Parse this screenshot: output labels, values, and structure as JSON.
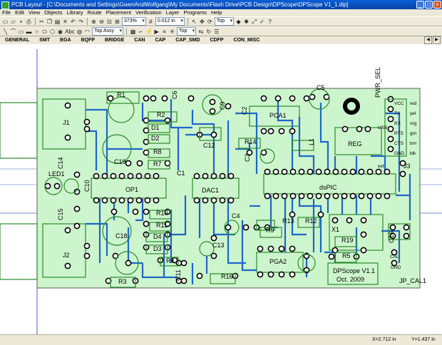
{
  "window": {
    "title": "PCB Layout - [C:\\Documents and Settings\\GwenAndWolfgang\\My Documents\\Flash Drive\\PCB Design\\DPScope\\DPScope V1_1.dip]"
  },
  "menu": [
    "File",
    "Edit",
    "View",
    "Objects",
    "Library",
    "Route",
    "Placement",
    "Verification",
    "Layer",
    "Programs",
    "Help"
  ],
  "toolbar1": {
    "zoom_value": "373%",
    "grid_value": "0.012 in",
    "layer_value": "Top"
  },
  "toolbar2": {
    "layer_pair_value": "Top Assy",
    "text_label": "Abc",
    "route_layer_value": "Top"
  },
  "component_tabs": [
    "GENERAL",
    "SMT",
    "BGA",
    "BQFP",
    "BRIDGE",
    "CAN",
    "CAP",
    "CAP_SMD",
    "CDFP",
    "CON_MISC"
  ],
  "board": {
    "refs": [
      "R1",
      "C6",
      "C9",
      "C5",
      "PWR_SEL",
      "C2",
      "PCA1",
      "VCC",
      "red",
      "TX",
      "yel",
      "RX",
      "org",
      "RTS",
      "grn",
      "CTS",
      "brn",
      "GND",
      "blk",
      "J1",
      "R2",
      "D1",
      "D2",
      "C12",
      "R14",
      "L1",
      "REG",
      "USB",
      "R8",
      "R7",
      "C19",
      "C3",
      "C14",
      "LED1",
      "C10",
      "OP1",
      "C1",
      "DAC1",
      "dsPIC",
      "J3",
      "ext",
      "C15",
      "C4",
      "R10",
      "R11",
      "R13",
      "D4",
      "D3",
      "R4",
      "C18",
      "R9",
      "R12",
      "X1",
      "R19",
      "C16",
      "J2",
      "C13",
      "PGA2",
      "R5",
      "CAL",
      "GND",
      "C11",
      "R16",
      "R3",
      "JP_CAL1"
    ],
    "logo_line1": "DPScope V1.1",
    "logo_line2": "Oct. 2009"
  },
  "status": {
    "x": "X=2.712 in",
    "y": "Y=1.437 in"
  }
}
